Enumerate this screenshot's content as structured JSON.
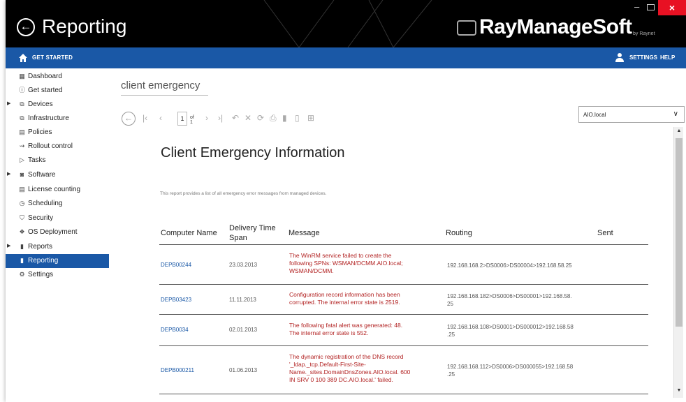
{
  "app": {
    "title": "Reporting",
    "brand": "RayManageSoft",
    "brand_sub": "by Raynet",
    "window_controls": {
      "minimize": "–",
      "close": "×"
    }
  },
  "topbar": {
    "get_started": "GET STARTED",
    "settings": "SETTINGS",
    "help": "HELP",
    "color": "#1a58a6"
  },
  "sidebar": {
    "items": [
      {
        "label": "Dashboard",
        "icon": "dashboard-icon",
        "glyph": "▦"
      },
      {
        "label": "Get started",
        "icon": "info-icon",
        "glyph": "ⓘ"
      },
      {
        "label": "Devices",
        "icon": "devices-icon",
        "glyph": "⧉"
      },
      {
        "label": "Infrastructure",
        "icon": "infrastructure-icon",
        "glyph": "⧉"
      },
      {
        "label": "Policies",
        "icon": "policies-icon",
        "glyph": "▤"
      },
      {
        "label": "Rollout control",
        "icon": "rollout-icon",
        "glyph": "⇝"
      },
      {
        "label": "Tasks",
        "icon": "tasks-icon",
        "glyph": "▷"
      },
      {
        "label": "Software",
        "icon": "software-icon",
        "glyph": "◙"
      },
      {
        "label": "License counting",
        "icon": "license-icon",
        "glyph": "▤"
      },
      {
        "label": "Scheduling",
        "icon": "clock-icon",
        "glyph": "◷"
      },
      {
        "label": "Security",
        "icon": "shield-icon",
        "glyph": "⛉"
      },
      {
        "label": "OS Deployment",
        "icon": "os-deployment-icon",
        "glyph": "❖"
      },
      {
        "label": "Reports",
        "icon": "reports-icon",
        "glyph": "▮"
      },
      {
        "label": "Reporting",
        "icon": "reporting-icon",
        "glyph": "▮"
      },
      {
        "label": "Settings",
        "icon": "gear-icon",
        "glyph": "⚙"
      }
    ]
  },
  "breadcrumb": "client emergency",
  "toolbar": {
    "page": "1",
    "of": "of 1"
  },
  "domain_select": {
    "value": "AIO.local"
  },
  "report": {
    "title": "Client Emergency Information",
    "description": "This report provides a list of all emergency error messages from managed devices.",
    "columns": {
      "computer": "Computer Name",
      "delivery_1": "Delivery Time",
      "delivery_2": "Span",
      "message": "Message",
      "routing": "Routing",
      "sent": "Sent"
    },
    "rows": [
      {
        "computer": "DEPB00244",
        "date": "23.03.2013",
        "message": [
          "The WinRM service failed to create the",
          "following SPNs: WSMAN/DCMM.AIO.local;",
          "WSMAN/DCMM."
        ],
        "routing": [
          "192.168.168.2>DS0006>DS00004>192.168.58.25"
        ]
      },
      {
        "computer": "DEPB03423",
        "date": "11.11.2013",
        "message": [
          "Configuration record information has been",
          "corrupted. The internal error state is 2519."
        ],
        "routing": [
          "192.168.168.182>DS0006>DS00001>192.168.58.",
          "25"
        ]
      },
      {
        "computer": "DEPB0034",
        "date": "02.01.2013",
        "message": [
          "The following fatal alert was generated: 48.",
          "The internal error state is 552."
        ],
        "routing": [
          "192.168.168.108>DS0001>DS000012>192.168.58",
          ".25"
        ]
      },
      {
        "computer": "DEPB000211",
        "date": "01.06.2013",
        "message": [
          "The dynamic registration of the DNS record",
          "'_ldap._tcp.Default-First-Site-",
          "Name._sites.DomainDnsZones.AIO.local. 600",
          "IN SRV 0 100 389 DC.AIO.local.' failed."
        ],
        "routing": [
          "192.168.168.112>DS0006>DS000055>192.168.58",
          ".25"
        ]
      }
    ]
  },
  "colors": {
    "accent": "#1a58a6",
    "titlebar": "#000000",
    "error_text": "#b22222",
    "close": "#e81123"
  }
}
